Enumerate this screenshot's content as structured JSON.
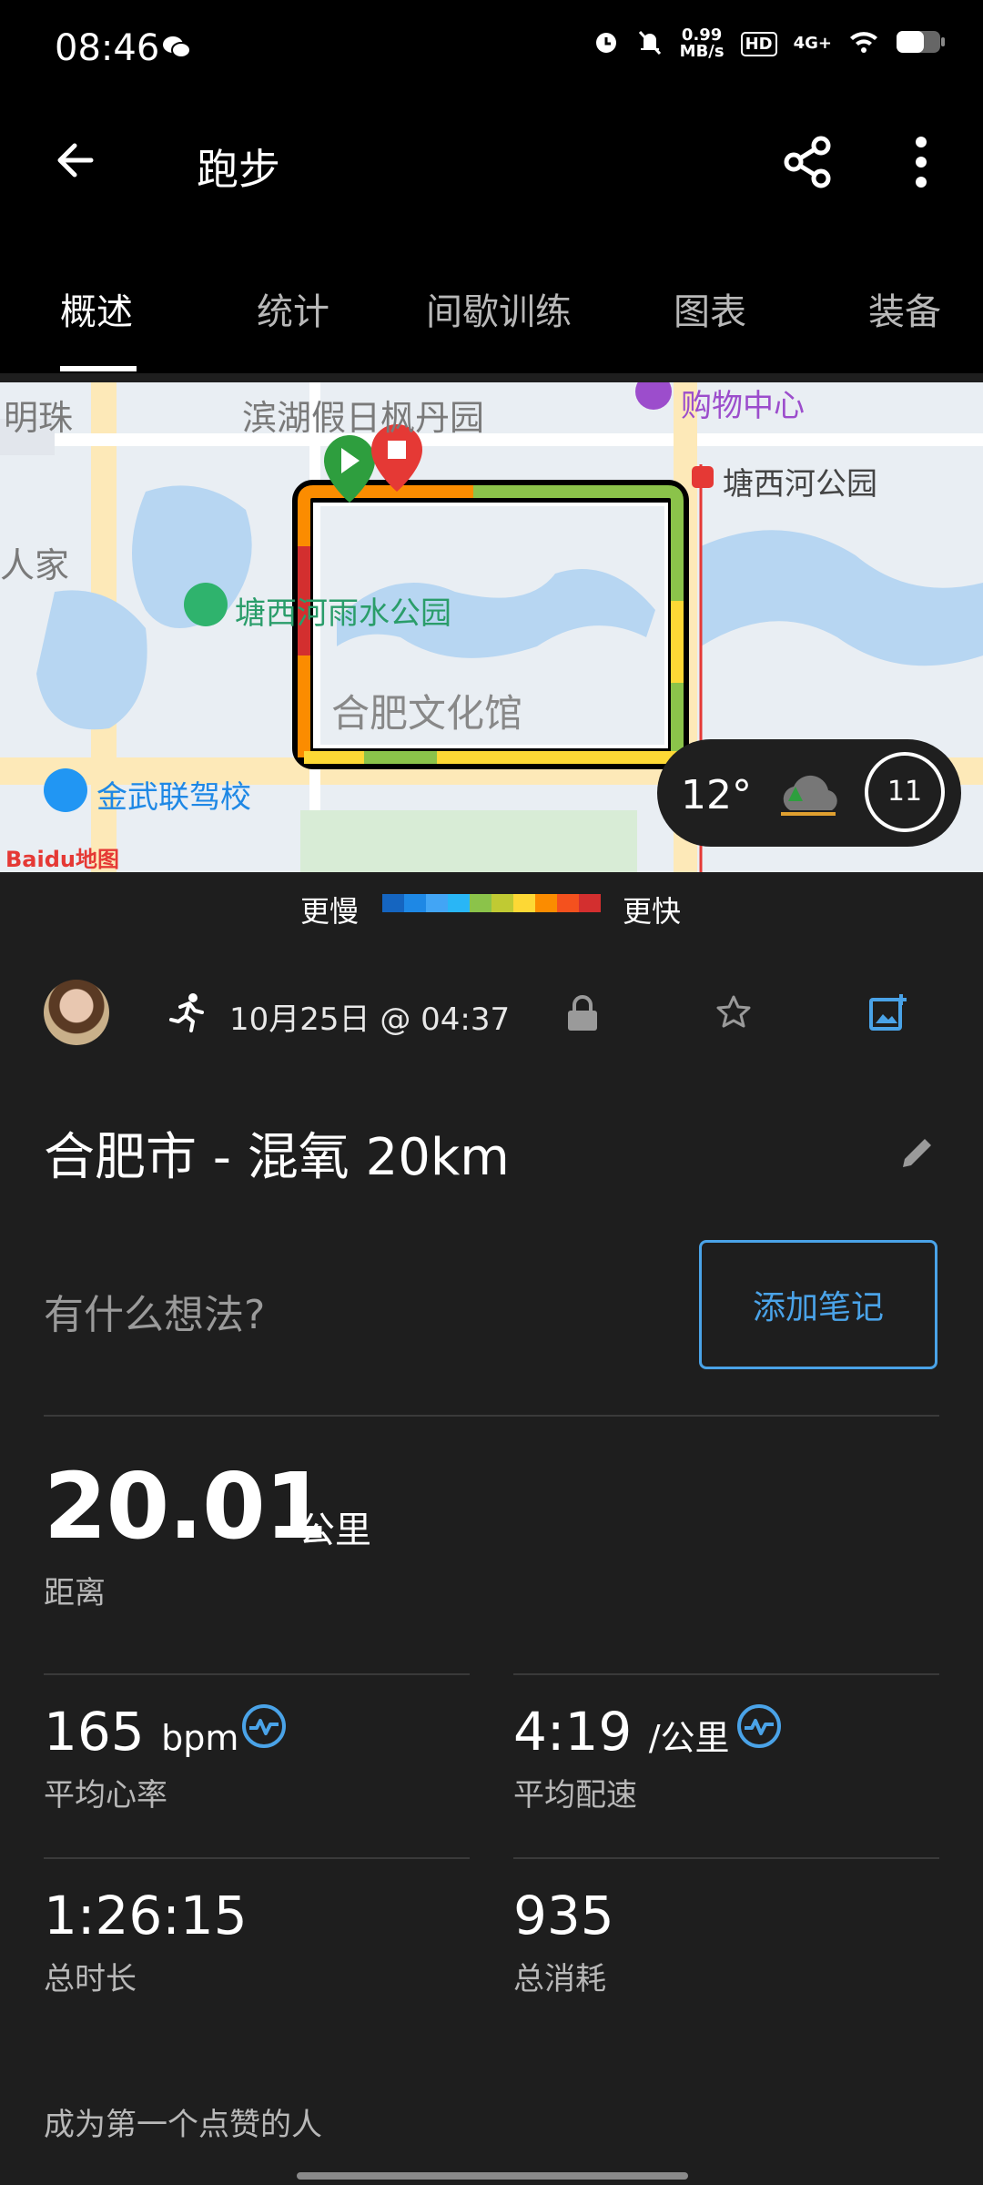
{
  "status_bar": {
    "time": "08:46",
    "net_speed_value": "0.99",
    "net_speed_unit": "MB/s",
    "hd": "HD",
    "signal": "4G+"
  },
  "app_bar": {
    "title": "跑步"
  },
  "tabs": [
    {
      "label": "概述",
      "active": true
    },
    {
      "label": "统计",
      "active": false
    },
    {
      "label": "间歇训练",
      "active": false
    },
    {
      "label": "图表",
      "active": false
    },
    {
      "label": "装备",
      "active": false
    }
  ],
  "map": {
    "labels": [
      "明珠",
      "滨湖假日枫丹园",
      "购物中心",
      "塘西河公园",
      "人家",
      "塘西河雨水公园",
      "合肥文化馆",
      "金武联驾校",
      "Baidu地图"
    ],
    "weather": {
      "temperature": "12°",
      "wind": "11"
    }
  },
  "legend": {
    "slower": "更慢",
    "faster": "更快",
    "colors": [
      "#1565c0",
      "#1e88e5",
      "#42a5f5",
      "#29b6f6",
      "#8bc34a",
      "#c0ca33",
      "#fdd835",
      "#fb8c00",
      "#f4511e",
      "#d32f2f"
    ]
  },
  "activity": {
    "date": "10月25日 @ 04:37",
    "name": "合肥市 - 混氧 20km",
    "notes_prompt": "有什么想法?",
    "add_note_label": "添加笔记"
  },
  "stats": {
    "distance": {
      "value": "20.01",
      "unit": "公里",
      "label": "距离"
    },
    "avg_hr": {
      "value": "165",
      "unit": "bpm",
      "label": "平均心率"
    },
    "avg_pace": {
      "value": "4:19",
      "unit": "/公里",
      "label": "平均配速"
    },
    "total_time": {
      "value": "1:26:15",
      "label": "总时长"
    },
    "calories": {
      "value": "935",
      "label": "总消耗"
    }
  },
  "kudos": "成为第一个点赞的人",
  "colors": {
    "accent": "#4aa3e8",
    "background": "#1e1e1e",
    "bar": "#000000"
  }
}
